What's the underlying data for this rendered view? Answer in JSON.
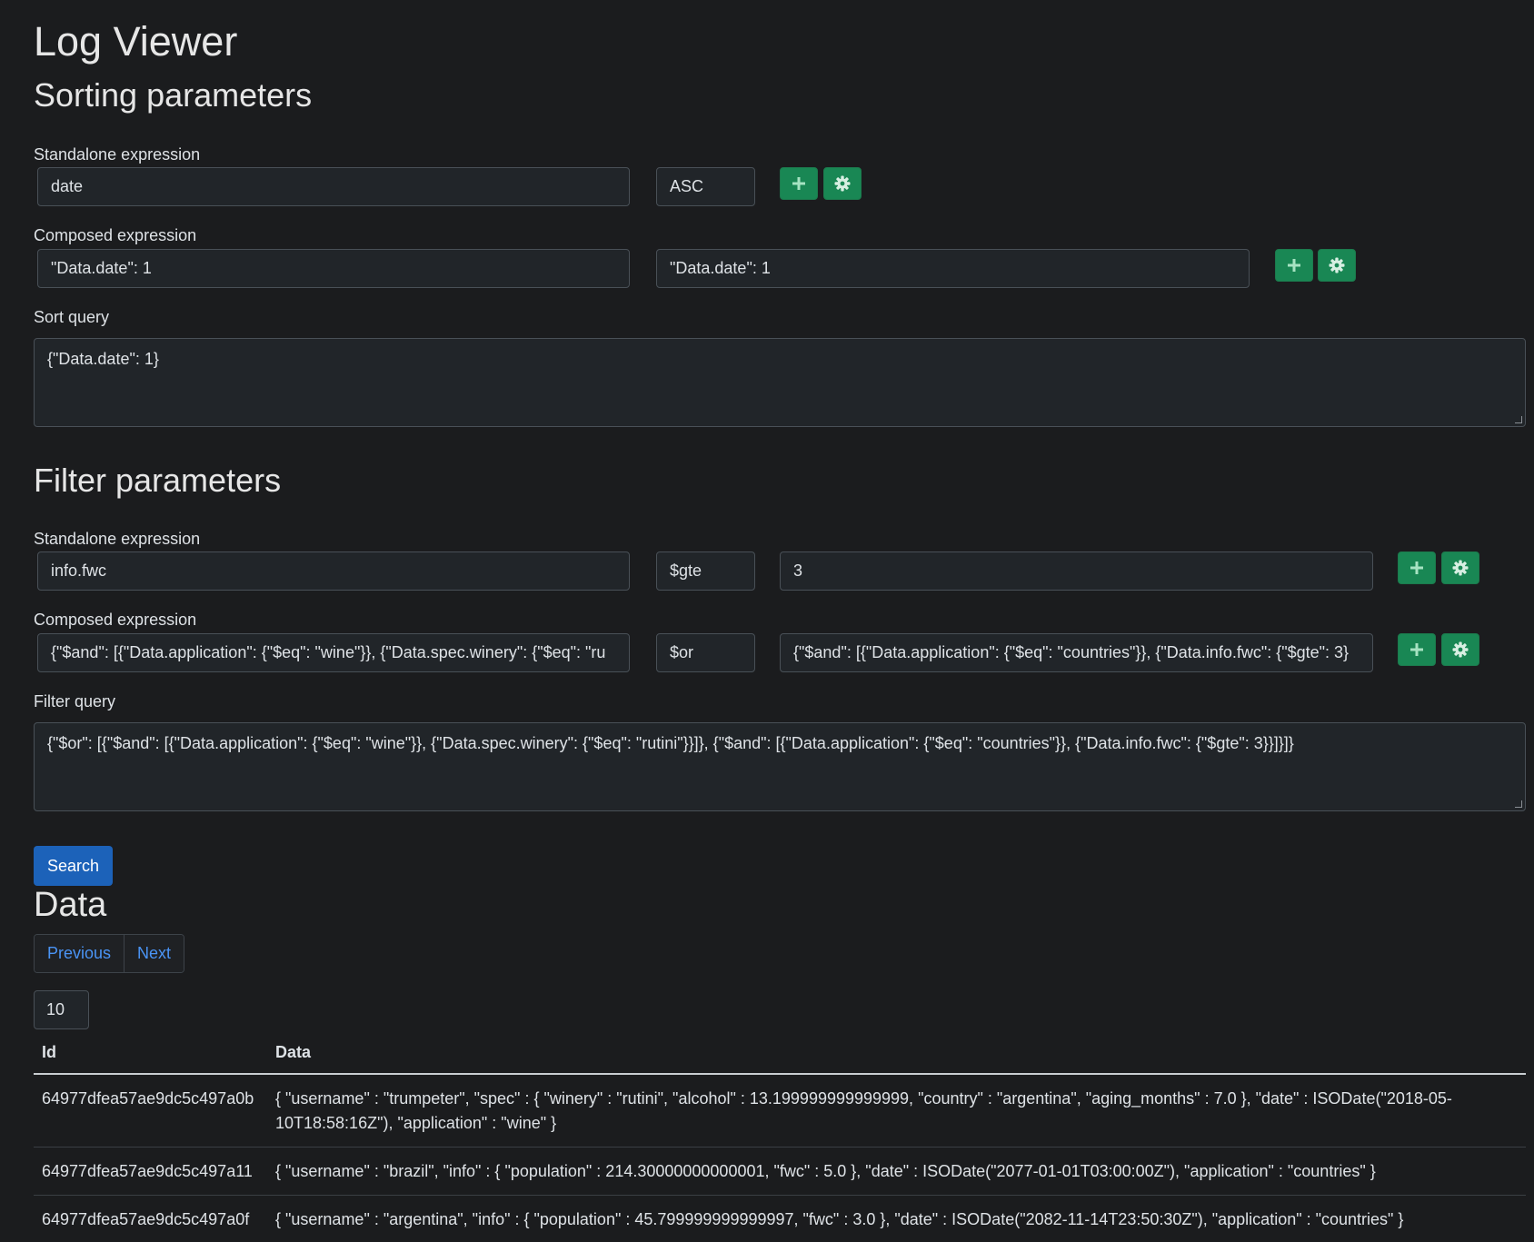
{
  "app_title": "Log Viewer",
  "sorting": {
    "heading": "Sorting parameters",
    "standalone_label": "Standalone expression",
    "standalone_field": "date",
    "standalone_order": "ASC",
    "composed_label": "Composed expression",
    "composed_left": "\"Data.date\": 1",
    "composed_right": "\"Data.date\": 1",
    "query_label": "Sort query",
    "query": "{\"Data.date\": 1}"
  },
  "filter": {
    "heading": "Filter parameters",
    "standalone_label": "Standalone expression",
    "standalone_field": "info.fwc",
    "standalone_operator": "$gte",
    "standalone_value": "3",
    "composed_label": "Composed expression",
    "composed_left": "{\"$and\": [{\"Data.application\": {\"$eq\": \"wine\"}}, {\"Data.spec.winery\": {\"$eq\": \"ru",
    "composed_operator": "$or",
    "composed_right": "{\"$and\": [{\"Data.application\": {\"$eq\": \"countries\"}}, {\"Data.info.fwc\": {\"$gte\": 3}",
    "query_label": "Filter query",
    "query": "{\"$or\": [{\"$and\": [{\"Data.application\": {\"$eq\": \"wine\"}}, {\"Data.spec.winery\": {\"$eq\": \"rutini\"}}]}, {\"$and\": [{\"Data.application\": {\"$eq\": \"countries\"}}, {\"Data.info.fwc\": {\"$gte\": 3}}]}]}"
  },
  "search_label": "Search",
  "data_section": {
    "heading": "Data",
    "previous_label": "Previous",
    "next_label": "Next",
    "page_size": "10",
    "columns": [
      "Id",
      "Data"
    ],
    "rows": [
      {
        "id": "64977dfea57ae9dc5c497a0b",
        "data": "{ \"username\" : \"trumpeter\", \"spec\" : { \"winery\" : \"rutini\", \"alcohol\" : 13.199999999999999, \"country\" : \"argentina\", \"aging_months\" : 7.0 }, \"date\" : ISODate(\"2018-05-10T18:58:16Z\"), \"application\" : \"wine\" }"
      },
      {
        "id": "64977dfea57ae9dc5c497a11",
        "data": "{ \"username\" : \"brazil\", \"info\" : { \"population\" : 214.30000000000001, \"fwc\" : 5.0 }, \"date\" : ISODate(\"2077-01-01T03:00:00Z\"), \"application\" : \"countries\" }"
      },
      {
        "id": "64977dfea57ae9dc5c497a0f",
        "data": "{ \"username\" : \"argentina\", \"info\" : { \"population\" : 45.799999999999997, \"fwc\" : 3.0 }, \"date\" : ISODate(\"2082-11-14T23:50:30Z\"), \"application\" : \"countries\" }"
      }
    ]
  }
}
